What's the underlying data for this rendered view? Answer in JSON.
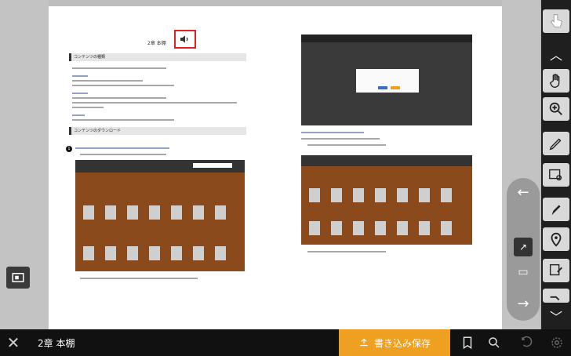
{
  "bottom_bar": {
    "chapter_title": "2章 本棚",
    "write_button": "書き込み保存"
  },
  "page": {
    "heading": "2章 本棚",
    "section1": "コンテンツの種類",
    "section2": "コンテンツのダウンロード"
  },
  "icons": {
    "close": "close-icon",
    "speaker": "speaker-icon",
    "bookmark": "bookmark-icon",
    "search": "search-icon",
    "undo": "undo-icon",
    "settings": "settings-icon"
  },
  "colors": {
    "accent": "#f0a020",
    "highlight": "#e02020",
    "shelf": "#a0541e"
  }
}
